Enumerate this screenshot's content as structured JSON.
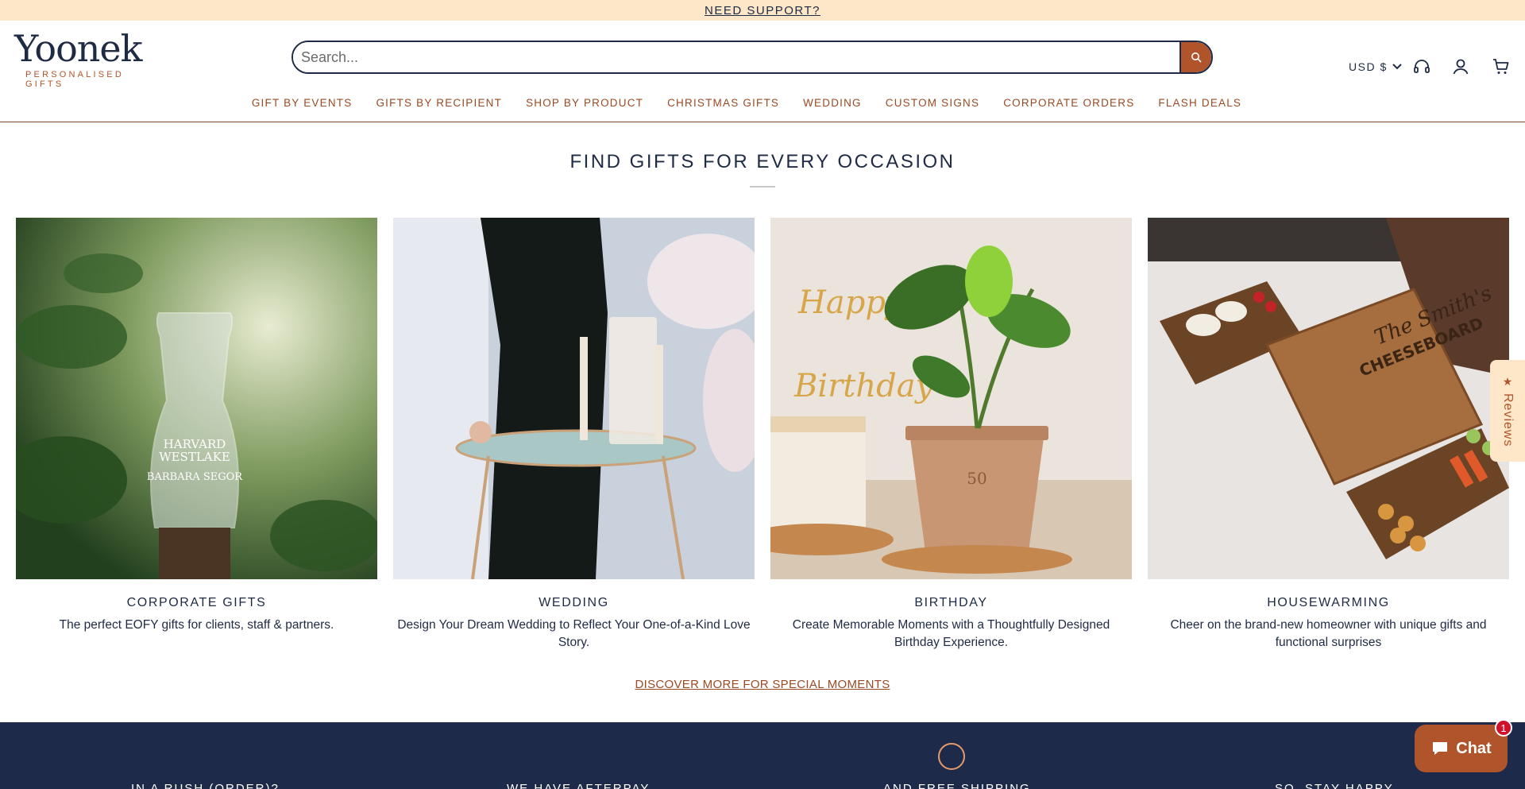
{
  "announcement": {
    "link": "NEED SUPPORT?"
  },
  "header": {
    "logo_word": "Yoonek",
    "logo_sub": "PERSONALISED GIFTS",
    "search_placeholder": "Search...",
    "currency": "USD $",
    "icons": [
      "search-icon",
      "chevron-down-icon",
      "support-headset-icon",
      "account-icon",
      "cart-icon"
    ]
  },
  "nav": {
    "items": [
      "GIFT BY EVENTS",
      "GIFTS BY RECIPIENT",
      "SHOP BY PRODUCT",
      "CHRISTMAS GIFTS",
      "WEDDING",
      "CUSTOM SIGNS",
      "CORPORATE ORDERS",
      "FLASH DEALS"
    ]
  },
  "section": {
    "title": "FIND GIFTS FOR EVERY OCCASION",
    "cards": [
      {
        "title": "CORPORATE GIFTS",
        "desc": "The perfect EOFY gifts for clients, staff & partners.",
        "image": "engraved glass vase among leaves"
      },
      {
        "title": "WEDDING",
        "desc": "Design Your Dream Wedding to Reflect Your One-of-a-Kind Love Story.",
        "image": "couple holding hands with unity candles"
      },
      {
        "title": "BIRTHDAY",
        "desc": "Create Memorable Moments with a Thoughtfully Designed Birthday Experience.",
        "image": "engraved plant pot with birthday cake"
      },
      {
        "title": "HOUSEWARMING",
        "desc": "Cheer on the brand-new homeowner with unique gifts and functional surprises",
        "image": "engraved cheeseboard with snacks"
      }
    ],
    "discover_link": "DISCOVER MORE FOR SPECIAL MOMENTS"
  },
  "footer": {
    "columns": [
      "IN A RUSH (ORDER)?",
      "WE HAVE AFTERPAY",
      "AND FREE SHIPPING",
      "SO, STAY HAPPY"
    ]
  },
  "widgets": {
    "reviews_label": "Reviews",
    "chat_label": "Chat",
    "chat_badge": "1"
  },
  "colors": {
    "brand_navy": "#1f2a44",
    "brand_copper": "#b0552b",
    "announcement_bg": "#fde7c8",
    "footer_bg": "#1e2a4a"
  }
}
